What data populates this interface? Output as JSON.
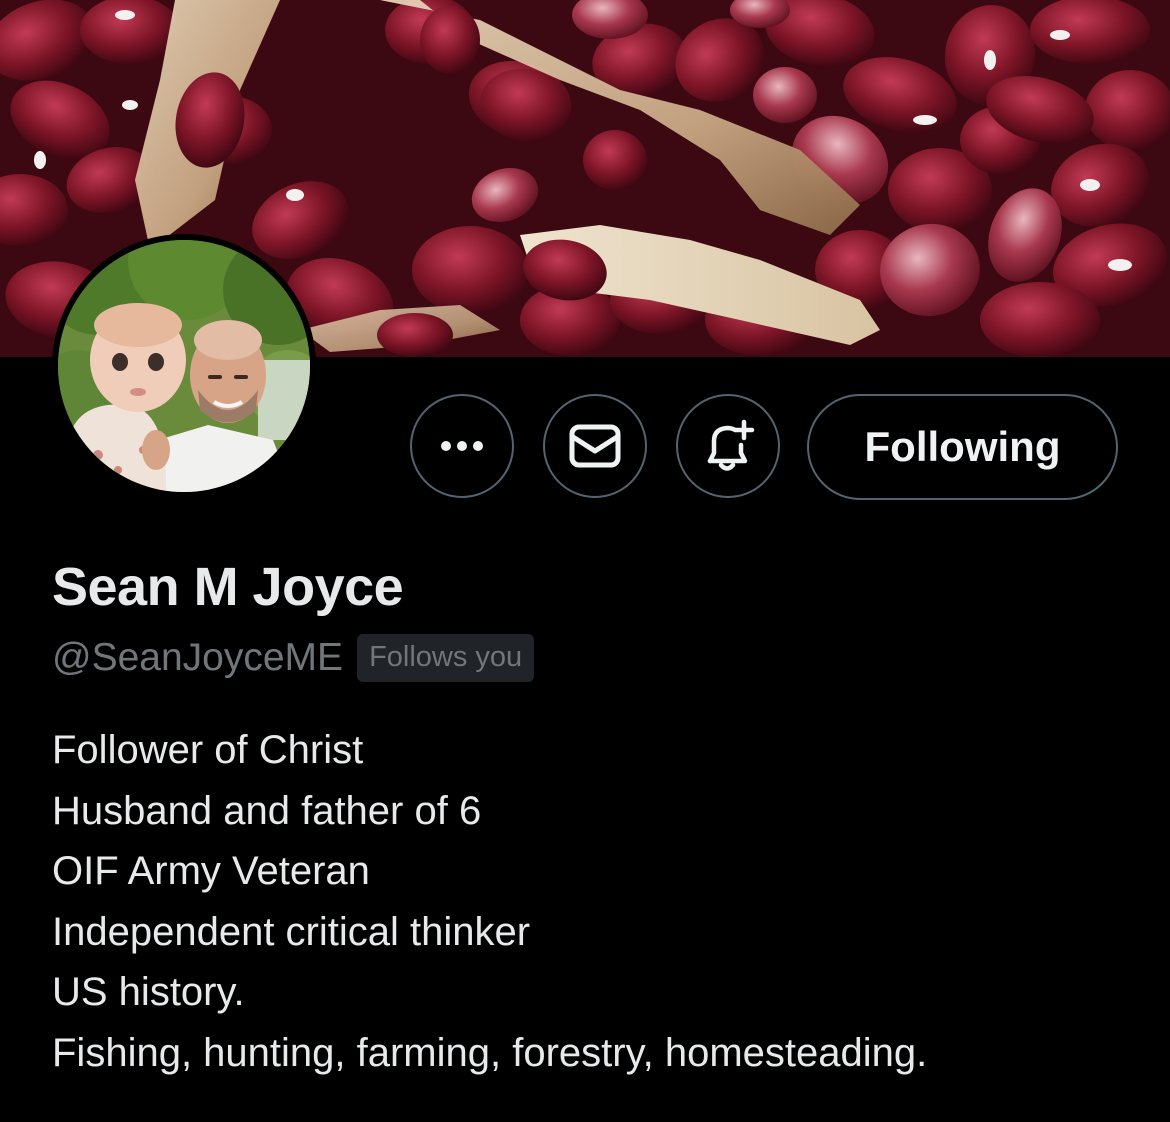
{
  "profile": {
    "display_name": "Sean M Joyce",
    "handle": "@SeanJoyceME",
    "follows_you_badge": "Follows you",
    "bio_lines": [
      "Follower of Christ",
      "Husband and father of 6",
      "OIF Army Veteran",
      "Independent critical thinker",
      "US history.",
      "Fishing, hunting, farming, forestry, homesteading."
    ]
  },
  "actions": {
    "more_icon": "more-horizontal-icon",
    "message_icon": "envelope-icon",
    "notify_icon": "bell-plus-icon",
    "following_label": "Following"
  },
  "colors": {
    "background": "#000000",
    "text_primary": "#e7e9ea",
    "text_secondary": "#71767b",
    "border": "#536471",
    "badge_bg": "#202327",
    "bean_red": "#7d1527"
  }
}
